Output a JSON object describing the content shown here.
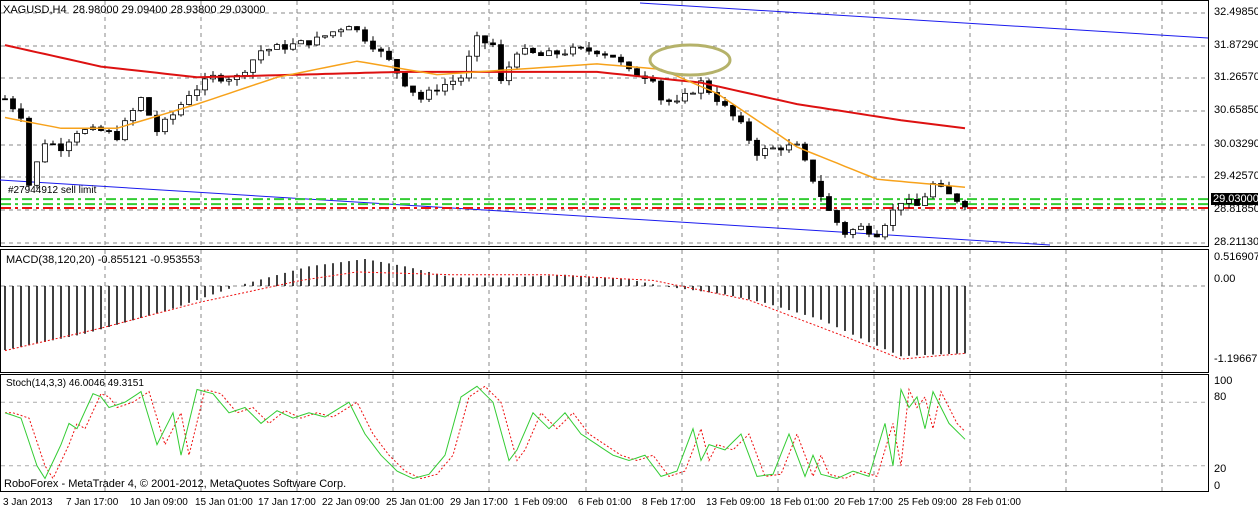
{
  "header": {
    "symbol": "XAGUSD,H4",
    "open": "28.98000",
    "high": "29.09400",
    "low": "28.93800",
    "close": "29.03000"
  },
  "order_label": "#27944912 sell limit",
  "current_price": "29.03000",
  "price_axis": [
    "32.49850",
    "31.87290",
    "31.26570",
    "30.65850",
    "30.03290",
    "29.42570",
    "28.81850",
    "28.21130"
  ],
  "macd": {
    "label": "MACD(38,120,20) -0.855121 -0.953553",
    "axis": [
      "0.516907",
      "0.00",
      "-1.196671"
    ]
  },
  "stoch": {
    "label": "Stoch(14,3,3) 46.0046 49.3151",
    "axis": [
      "100",
      "80",
      "20",
      "0"
    ]
  },
  "time_axis": [
    "3 Jan 2013",
    "7 Jan 17:00",
    "10 Jan 09:00",
    "15 Jan 01:00",
    "17 Jan 17:00",
    "22 Jan 09:00",
    "25 Jan 01:00",
    "29 Jan 17:00",
    "1 Feb 09:00",
    "6 Feb 01:00",
    "8 Feb 17:00",
    "13 Feb 09:00",
    "18 Feb 01:00",
    "20 Feb 17:00",
    "25 Feb 09:00",
    "28 Feb 01:00"
  ],
  "footer": "RoboForex - MetaTrader 4, © 2001-2012, MetaQuotes Software Corp.",
  "colors": {
    "fast_ma": "#f7a21b",
    "slow_ma": "#dd1111",
    "trend": "#1a1aee",
    "green": "#33cc33",
    "red": "#ee1111",
    "ellipse": "#b5b26a"
  },
  "chart_data": {
    "type": "line",
    "bars": 121,
    "close_keypoints": [
      [
        0,
        30.9
      ],
      [
        2,
        30.6
      ],
      [
        3,
        29.3
      ],
      [
        5,
        30.1
      ],
      [
        7,
        30.0
      ],
      [
        9,
        30.3
      ],
      [
        12,
        30.3
      ],
      [
        14,
        30.2
      ],
      [
        17,
        30.9
      ],
      [
        19,
        30.3
      ],
      [
        21,
        30.6
      ],
      [
        23,
        31.0
      ],
      [
        26,
        31.3
      ],
      [
        29,
        31.3
      ],
      [
        32,
        31.8
      ],
      [
        36,
        31.9
      ],
      [
        39,
        32.0
      ],
      [
        43,
        32.3
      ],
      [
        46,
        31.9
      ],
      [
        48,
        31.6
      ],
      [
        50,
        31.2
      ],
      [
        52,
        30.9
      ],
      [
        54,
        31.1
      ],
      [
        57,
        31.3
      ],
      [
        59,
        32.0
      ],
      [
        61,
        31.9
      ],
      [
        62,
        31.2
      ],
      [
        64,
        31.8
      ],
      [
        67,
        31.7
      ],
      [
        71,
        31.8
      ],
      [
        74,
        31.8
      ],
      [
        76,
        31.7
      ],
      [
        78,
        31.4
      ],
      [
        81,
        31.3
      ],
      [
        82,
        30.9
      ],
      [
        84,
        30.8
      ],
      [
        87,
        31.2
      ],
      [
        89,
        30.9
      ],
      [
        92,
        30.4
      ],
      [
        94,
        29.9
      ],
      [
        97,
        30.0
      ],
      [
        99,
        30.0
      ],
      [
        101,
        29.4
      ],
      [
        103,
        28.8
      ],
      [
        105,
        28.4
      ],
      [
        107,
        28.5
      ],
      [
        109,
        28.4
      ],
      [
        112,
        29.0
      ],
      [
        114,
        28.9
      ],
      [
        116,
        29.3
      ],
      [
        118,
        29.1
      ],
      [
        120,
        28.95
      ]
    ],
    "fast_ma": [
      [
        0,
        30.55
      ],
      [
        7,
        30.35
      ],
      [
        14,
        30.35
      ],
      [
        24,
        30.8
      ],
      [
        34,
        31.3
      ],
      [
        44,
        31.6
      ],
      [
        54,
        31.35
      ],
      [
        64,
        31.45
      ],
      [
        74,
        31.55
      ],
      [
        82,
        31.45
      ],
      [
        89,
        31.0
      ],
      [
        99,
        30.0
      ],
      [
        109,
        29.4
      ],
      [
        120,
        29.25
      ]
    ],
    "slow_ma": [
      [
        0,
        31.9
      ],
      [
        12,
        31.5
      ],
      [
        24,
        31.3
      ],
      [
        37,
        31.35
      ],
      [
        49,
        31.4
      ],
      [
        62,
        31.4
      ],
      [
        74,
        31.4
      ],
      [
        87,
        31.2
      ],
      [
        99,
        30.8
      ],
      [
        112,
        30.5
      ],
      [
        120,
        30.35
      ]
    ],
    "price_range": [
      28.2113,
      32.4985
    ],
    "sell_limit": 29.03,
    "macd_hist": [
      [
        0,
        -1.14
      ],
      [
        10,
        -0.85
      ],
      [
        20,
        -0.45
      ],
      [
        29,
        0.0
      ],
      [
        38,
        0.35
      ],
      [
        45,
        0.48
      ],
      [
        50,
        0.35
      ],
      [
        56,
        0.15
      ],
      [
        63,
        0.15
      ],
      [
        70,
        0.2
      ],
      [
        78,
        0.12
      ],
      [
        82,
        0.0
      ],
      [
        90,
        -0.15
      ],
      [
        95,
        -0.3
      ],
      [
        102,
        -0.6
      ],
      [
        108,
        -1.0
      ],
      [
        112,
        -1.25
      ],
      [
        116,
        -1.22
      ],
      [
        120,
        -1.2
      ]
    ],
    "macd_signal": [
      [
        0,
        -1.15
      ],
      [
        12,
        -0.75
      ],
      [
        24,
        -0.3
      ],
      [
        37,
        0.1
      ],
      [
        44,
        0.25
      ],
      [
        56,
        0.2
      ],
      [
        68,
        0.2
      ],
      [
        81,
        0.1
      ],
      [
        93,
        -0.25
      ],
      [
        105,
        -0.9
      ],
      [
        112,
        -1.3
      ],
      [
        116,
        -1.25
      ],
      [
        120,
        -1.2
      ]
    ],
    "macd_range": [
      -1.196671,
      0.516907
    ],
    "stoch_main": [
      [
        0,
        70
      ],
      [
        2,
        65
      ],
      [
        4,
        20
      ],
      [
        5,
        8
      ],
      [
        7,
        40
      ],
      [
        8,
        60
      ],
      [
        9,
        55
      ],
      [
        11,
        88
      ],
      [
        12,
        85
      ],
      [
        13,
        75
      ],
      [
        15,
        80
      ],
      [
        17,
        90
      ],
      [
        19,
        40
      ],
      [
        21,
        70
      ],
      [
        22,
        30
      ],
      [
        24,
        92
      ],
      [
        26,
        88
      ],
      [
        28,
        70
      ],
      [
        30,
        75
      ],
      [
        32,
        60
      ],
      [
        34,
        72
      ],
      [
        36,
        65
      ],
      [
        38,
        70
      ],
      [
        40,
        66
      ],
      [
        43,
        80
      ],
      [
        45,
        50
      ],
      [
        47,
        30
      ],
      [
        49,
        15
      ],
      [
        51,
        8
      ],
      [
        53,
        12
      ],
      [
        55,
        30
      ],
      [
        57,
        85
      ],
      [
        59,
        95
      ],
      [
        61,
        80
      ],
      [
        63,
        25
      ],
      [
        64,
        35
      ],
      [
        66,
        70
      ],
      [
        68,
        55
      ],
      [
        70,
        70
      ],
      [
        72,
        50
      ],
      [
        74,
        40
      ],
      [
        76,
        30
      ],
      [
        78,
        25
      ],
      [
        80,
        30
      ],
      [
        82,
        10
      ],
      [
        84,
        15
      ],
      [
        86,
        55
      ],
      [
        87,
        25
      ],
      [
        88,
        40
      ],
      [
        90,
        35
      ],
      [
        92,
        50
      ],
      [
        94,
        10
      ],
      [
        96,
        12
      ],
      [
        98,
        50
      ],
      [
        100,
        10
      ],
      [
        101,
        30
      ],
      [
        102,
        12
      ],
      [
        104,
        8
      ],
      [
        106,
        15
      ],
      [
        108,
        10
      ],
      [
        110,
        60
      ],
      [
        111,
        20
      ],
      [
        112,
        92
      ],
      [
        113,
        75
      ],
      [
        114,
        85
      ],
      [
        115,
        55
      ],
      [
        116,
        90
      ],
      [
        117,
        75
      ],
      [
        118,
        60
      ],
      [
        120,
        45
      ]
    ],
    "stoch_range": [
      0,
      100
    ]
  }
}
